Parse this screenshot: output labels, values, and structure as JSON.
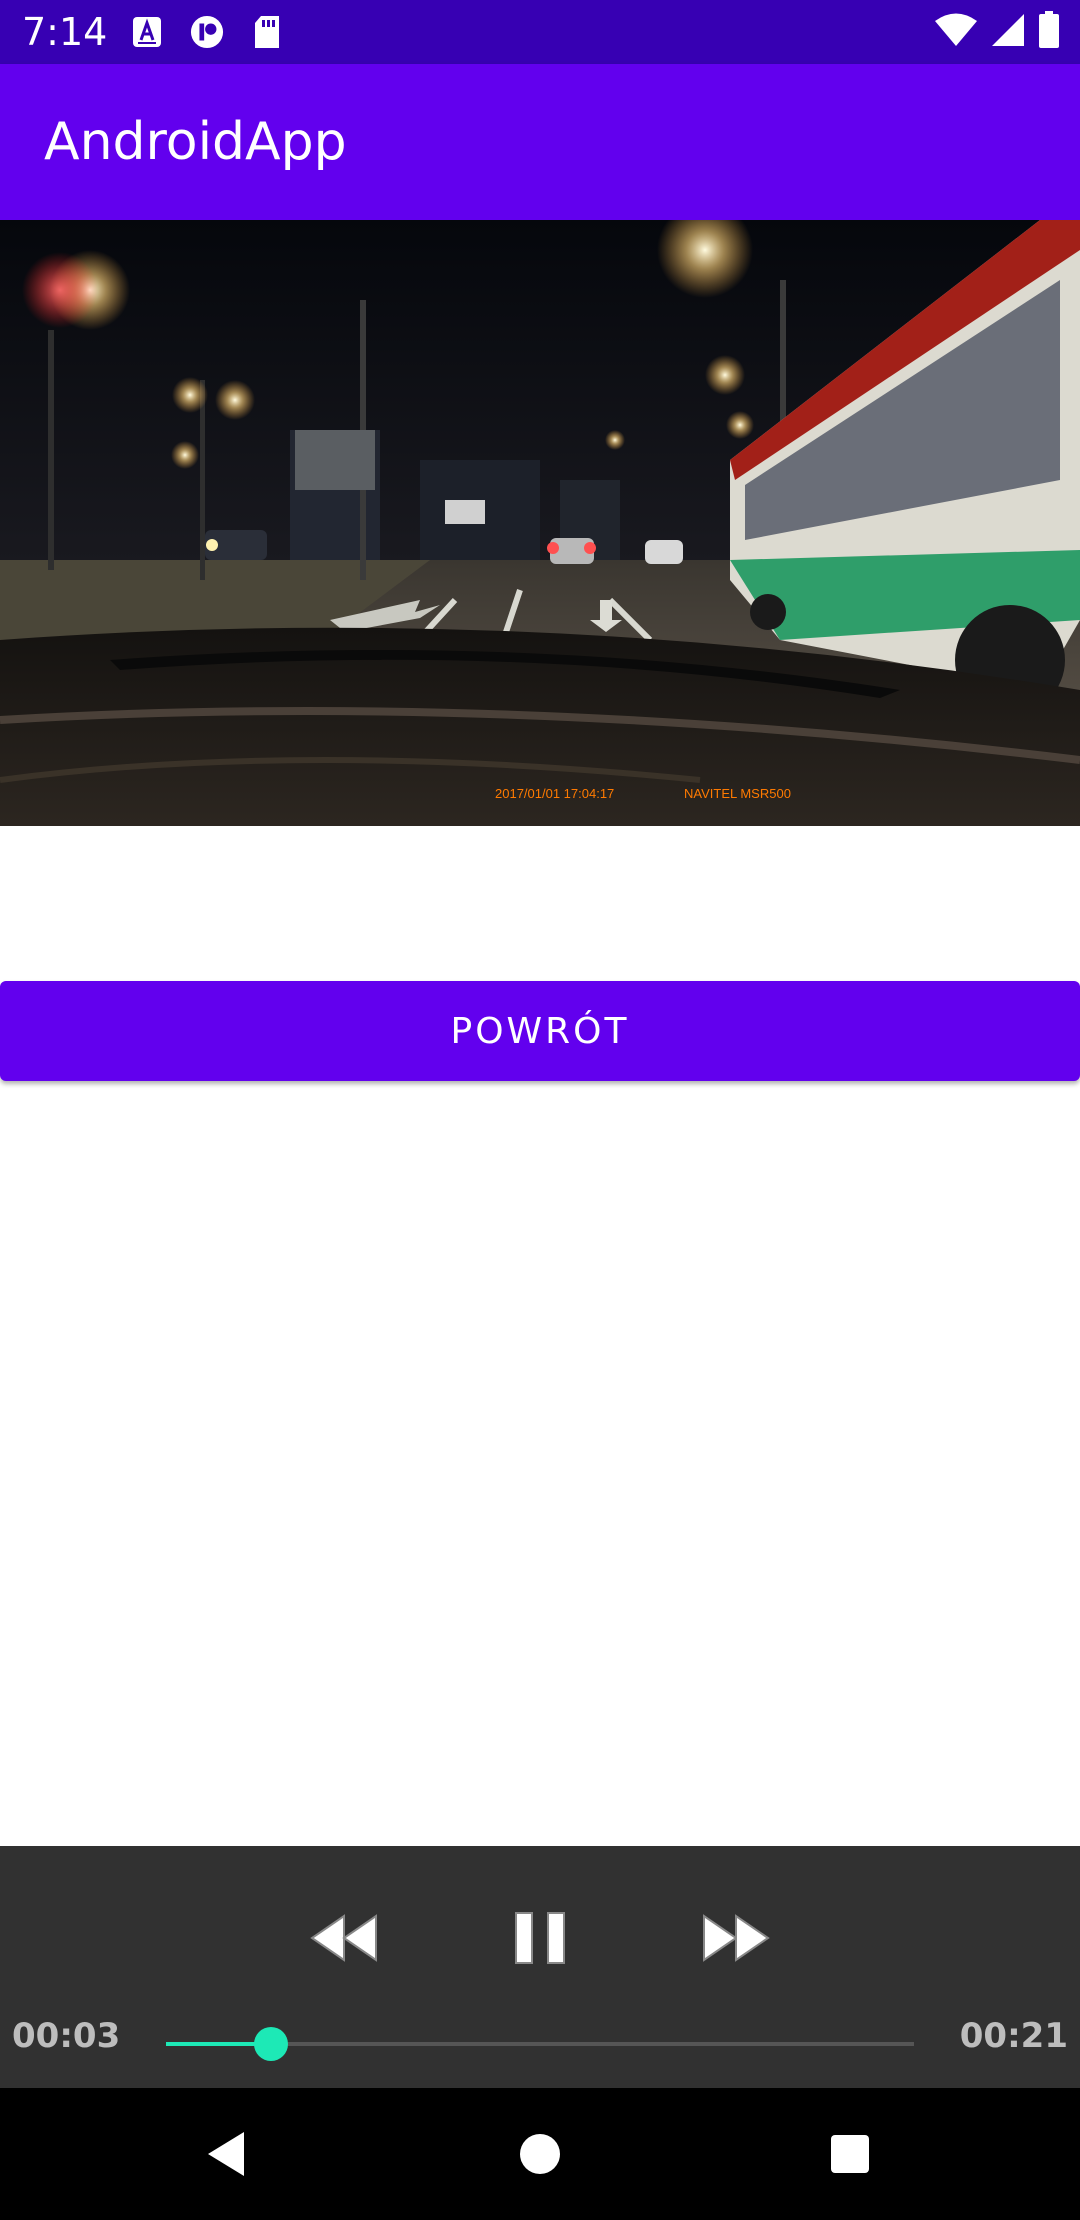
{
  "status_bar": {
    "time": "7:14",
    "icons": [
      "accessibility-a-icon",
      "record-icon",
      "sd-card-icon",
      "wifi-icon",
      "signal-icon",
      "battery-icon"
    ]
  },
  "app_bar": {
    "title": "AndroidApp"
  },
  "video": {
    "overlay_timestamp": "2017/01/01 17:04:17",
    "overlay_brand": "NAVITEL MSR500"
  },
  "back_button": {
    "label": "POWRÓT"
  },
  "media_controller": {
    "current_time": "00:03",
    "total_time": "00:21",
    "progress_fraction": 0.14,
    "accent_color": "#1de9b6",
    "icons": [
      "rewind-icon",
      "pause-icon",
      "fast-forward-icon"
    ]
  },
  "nav_bar": {
    "icons": [
      "back-triangle-icon",
      "home-circle-icon",
      "recents-square-icon"
    ]
  },
  "colors": {
    "primary": "#6200ee",
    "primary_dark": "#3700b3",
    "controller_bg": "#313131"
  }
}
